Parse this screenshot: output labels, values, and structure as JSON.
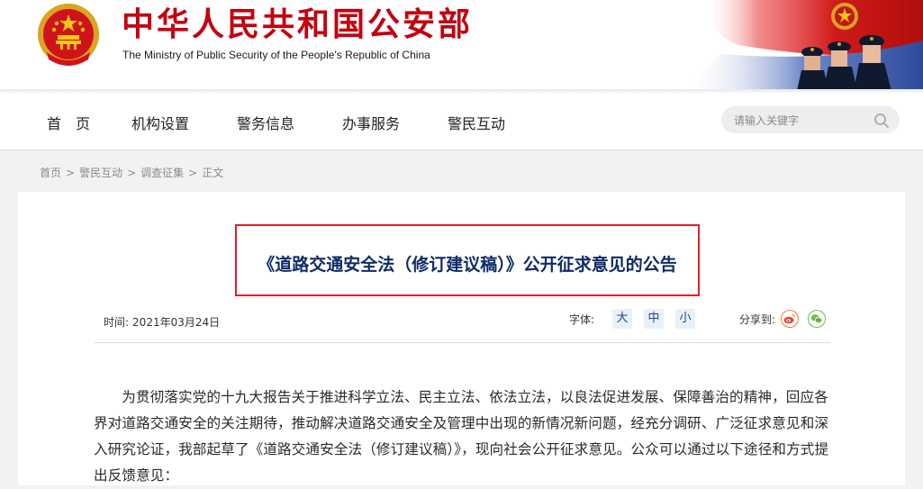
{
  "header": {
    "title_cn": "中华人民共和国公安部",
    "title_en": "The Ministry of Public Security of the People's Republic of China",
    "emblem_icon": "national-emblem-icon",
    "banner_image": "police-officers-flag-banner",
    "brand_color": "#c4000f"
  },
  "nav": {
    "items": [
      {
        "label": "首　页"
      },
      {
        "label": "机构设置"
      },
      {
        "label": "警务信息"
      },
      {
        "label": "办事服务"
      },
      {
        "label": "警民互动"
      }
    ],
    "search": {
      "placeholder": "请输入关键字",
      "icon": "search-icon"
    }
  },
  "breadcrumb": {
    "items": [
      "首页",
      "警民互动",
      "调查征集"
    ],
    "current": "正文",
    "separator": ">"
  },
  "article": {
    "title": "《道路交通安全法（修订建议稿）》公开征求意见的公告",
    "time_label": "时间:",
    "date": "2021年03月24日",
    "font_label": "字体:",
    "font_sizes": [
      "大",
      "中",
      "小"
    ],
    "share_label": "分享到:",
    "share_icons": [
      "weibo-icon",
      "wechat-icon"
    ],
    "highlight_color": "#e0202a",
    "paragraphs": [
      "为贯彻落实党的十九大报告关于推进科学立法、民主立法、依法立法，以良法促进发展、保障善治的精神，回应各界对道路交通安全的关注期待，推动解决道路交通安全及管理中出现的新情况新问题，经充分调研、广泛征求意见和深入研究论证，我部起草了《道路交通安全法（修订建议稿）》，现向社会公开征求意见。公众可以通过以下途径和方式提出反馈意见："
    ]
  }
}
